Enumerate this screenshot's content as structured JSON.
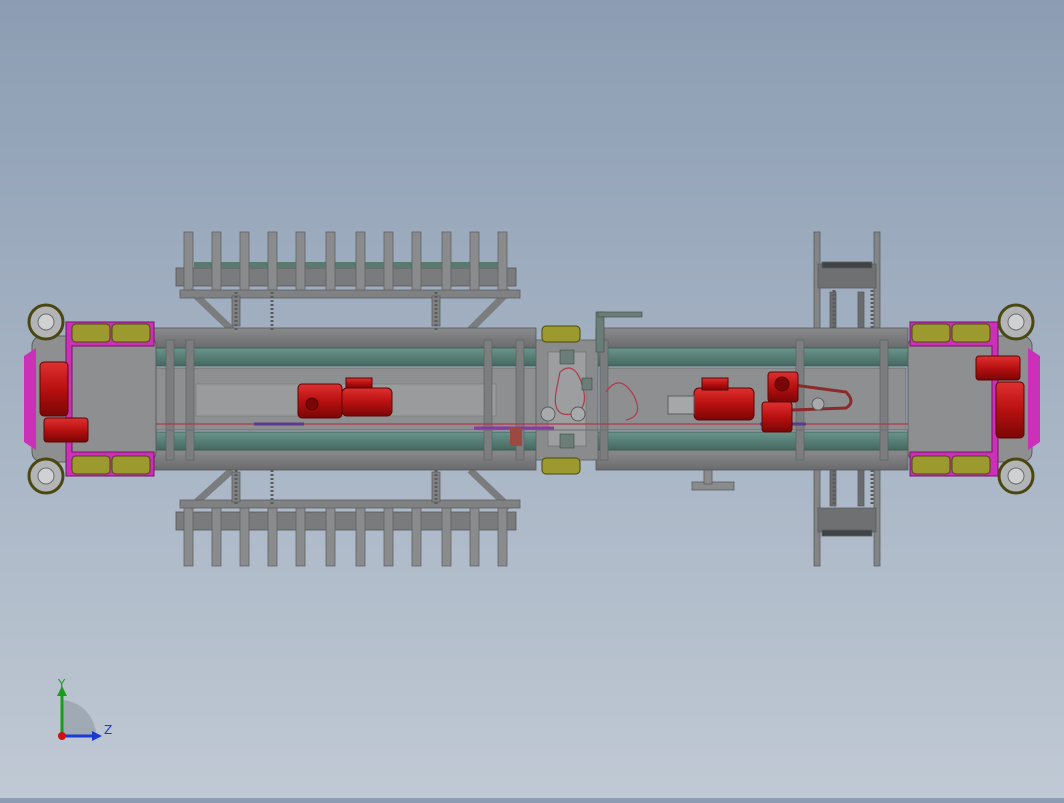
{
  "viewport": {
    "background_top": "#8c9db3",
    "background_bottom": "#c0c9d4"
  },
  "colors": {
    "frame": "#7e7e80",
    "frame_dark": "#5f6163",
    "frame_light": "#9a9b9d",
    "beam_teal": "#4f7a72",
    "beam_teal_light": "#6a958c",
    "motor_red": "#c41616",
    "motor_red_dark": "#8e0c0c",
    "magenta": "#cc2fb8",
    "wheel_olive": "#9c9a2e",
    "wheel_olive_dark": "#6f6d1c",
    "chain": "#b03a4a",
    "purple_rod": "#8a3aa0"
  },
  "icons": {
    "motor": "gear-motor-icon",
    "wheel": "wheel-icon",
    "sprocket": "sprocket-icon"
  },
  "triad": {
    "y_label": "Y",
    "z_label": "Z",
    "y_color": "#17a017",
    "z_color": "#1a3ad6",
    "origin_color": "#d01010"
  }
}
